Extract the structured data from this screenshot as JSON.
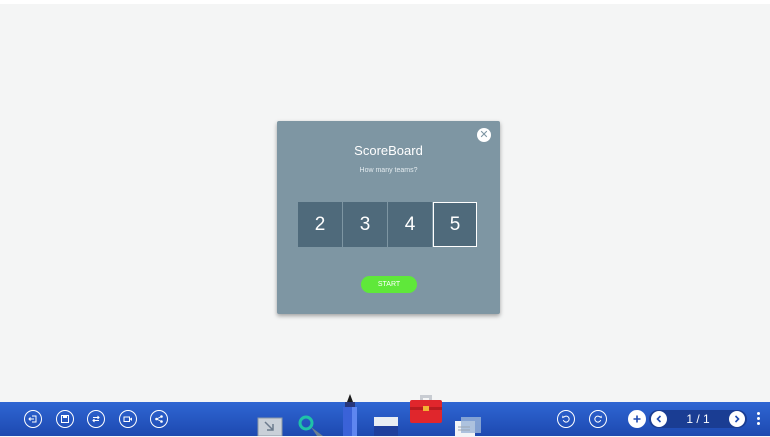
{
  "scoreboard": {
    "title": "ScoreBoard",
    "question": "How many teams?",
    "close_icon": "close-icon",
    "team_options": [
      "2",
      "3",
      "4",
      "5"
    ],
    "selected_option": "5",
    "start_label": "START",
    "colors": {
      "dialog_bg": "#7e96a3",
      "option_bg": "#4f6a7b",
      "start_bg": "#5fe83a"
    }
  },
  "toolbar": {
    "left_buttons": [
      {
        "name": "exit-icon"
      },
      {
        "name": "save-icon"
      },
      {
        "name": "switch-icon"
      },
      {
        "name": "record-icon"
      },
      {
        "name": "share-icon"
      }
    ],
    "tools": [
      {
        "name": "select-tool-icon"
      },
      {
        "name": "magnifier-tool-icon"
      },
      {
        "name": "pen-tool-icon"
      },
      {
        "name": "eraser-tool-icon"
      },
      {
        "name": "toolbox-icon"
      },
      {
        "name": "notes-icon"
      }
    ],
    "right_buttons": [
      {
        "name": "undo-icon"
      },
      {
        "name": "redo-icon"
      },
      {
        "name": "add-page-icon"
      }
    ],
    "page_indicator": "1 / 1",
    "accent": "#2f66d3"
  }
}
